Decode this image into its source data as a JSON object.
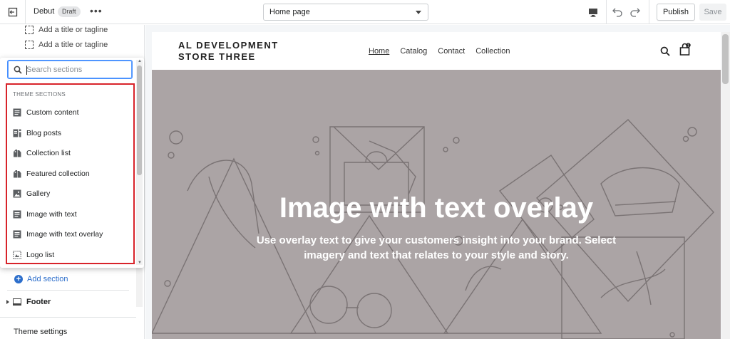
{
  "topbar": {
    "theme_name": "Debut",
    "status_badge": "Draft",
    "more_label": "•••",
    "page_select": "Home page",
    "publish_label": "Publish",
    "save_label": "Save"
  },
  "sidebar": {
    "blocks": [
      {
        "label": "Add a title or tagline"
      },
      {
        "label": "Add a title or tagline"
      }
    ],
    "add_section_label": "Add section",
    "footer_label": "Footer",
    "theme_settings_label": "Theme settings"
  },
  "popover": {
    "search": {
      "value": "",
      "placeholder": "Search sections"
    },
    "header": "THEME SECTIONS",
    "items": [
      {
        "label": "Custom content",
        "icon": "text-block-icon"
      },
      {
        "label": "Blog posts",
        "icon": "blog-icon"
      },
      {
        "label": "Collection list",
        "icon": "collection-icon"
      },
      {
        "label": "Featured collection",
        "icon": "collection-icon"
      },
      {
        "label": "Gallery",
        "icon": "image-icon"
      },
      {
        "label": "Image with text",
        "icon": "text-block-icon"
      },
      {
        "label": "Image with text overlay",
        "icon": "text-block-icon"
      },
      {
        "label": "Logo list",
        "icon": "logo-list-icon"
      }
    ]
  },
  "preview": {
    "store_name_line1": "AL DEVELOPMENT",
    "store_name_line2": "STORE THREE",
    "nav": [
      "Home",
      "Catalog",
      "Contact",
      "Collection"
    ],
    "cart_count": "1",
    "hero_title": "Image with text overlay",
    "hero_text": "Use overlay text to give your customers insight into your brand. Select imagery and text that relates to your style and story."
  },
  "colors": {
    "accent": "#2c6ecb",
    "highlight_border": "#d8232a",
    "hero_bg": "#aba4a5"
  }
}
